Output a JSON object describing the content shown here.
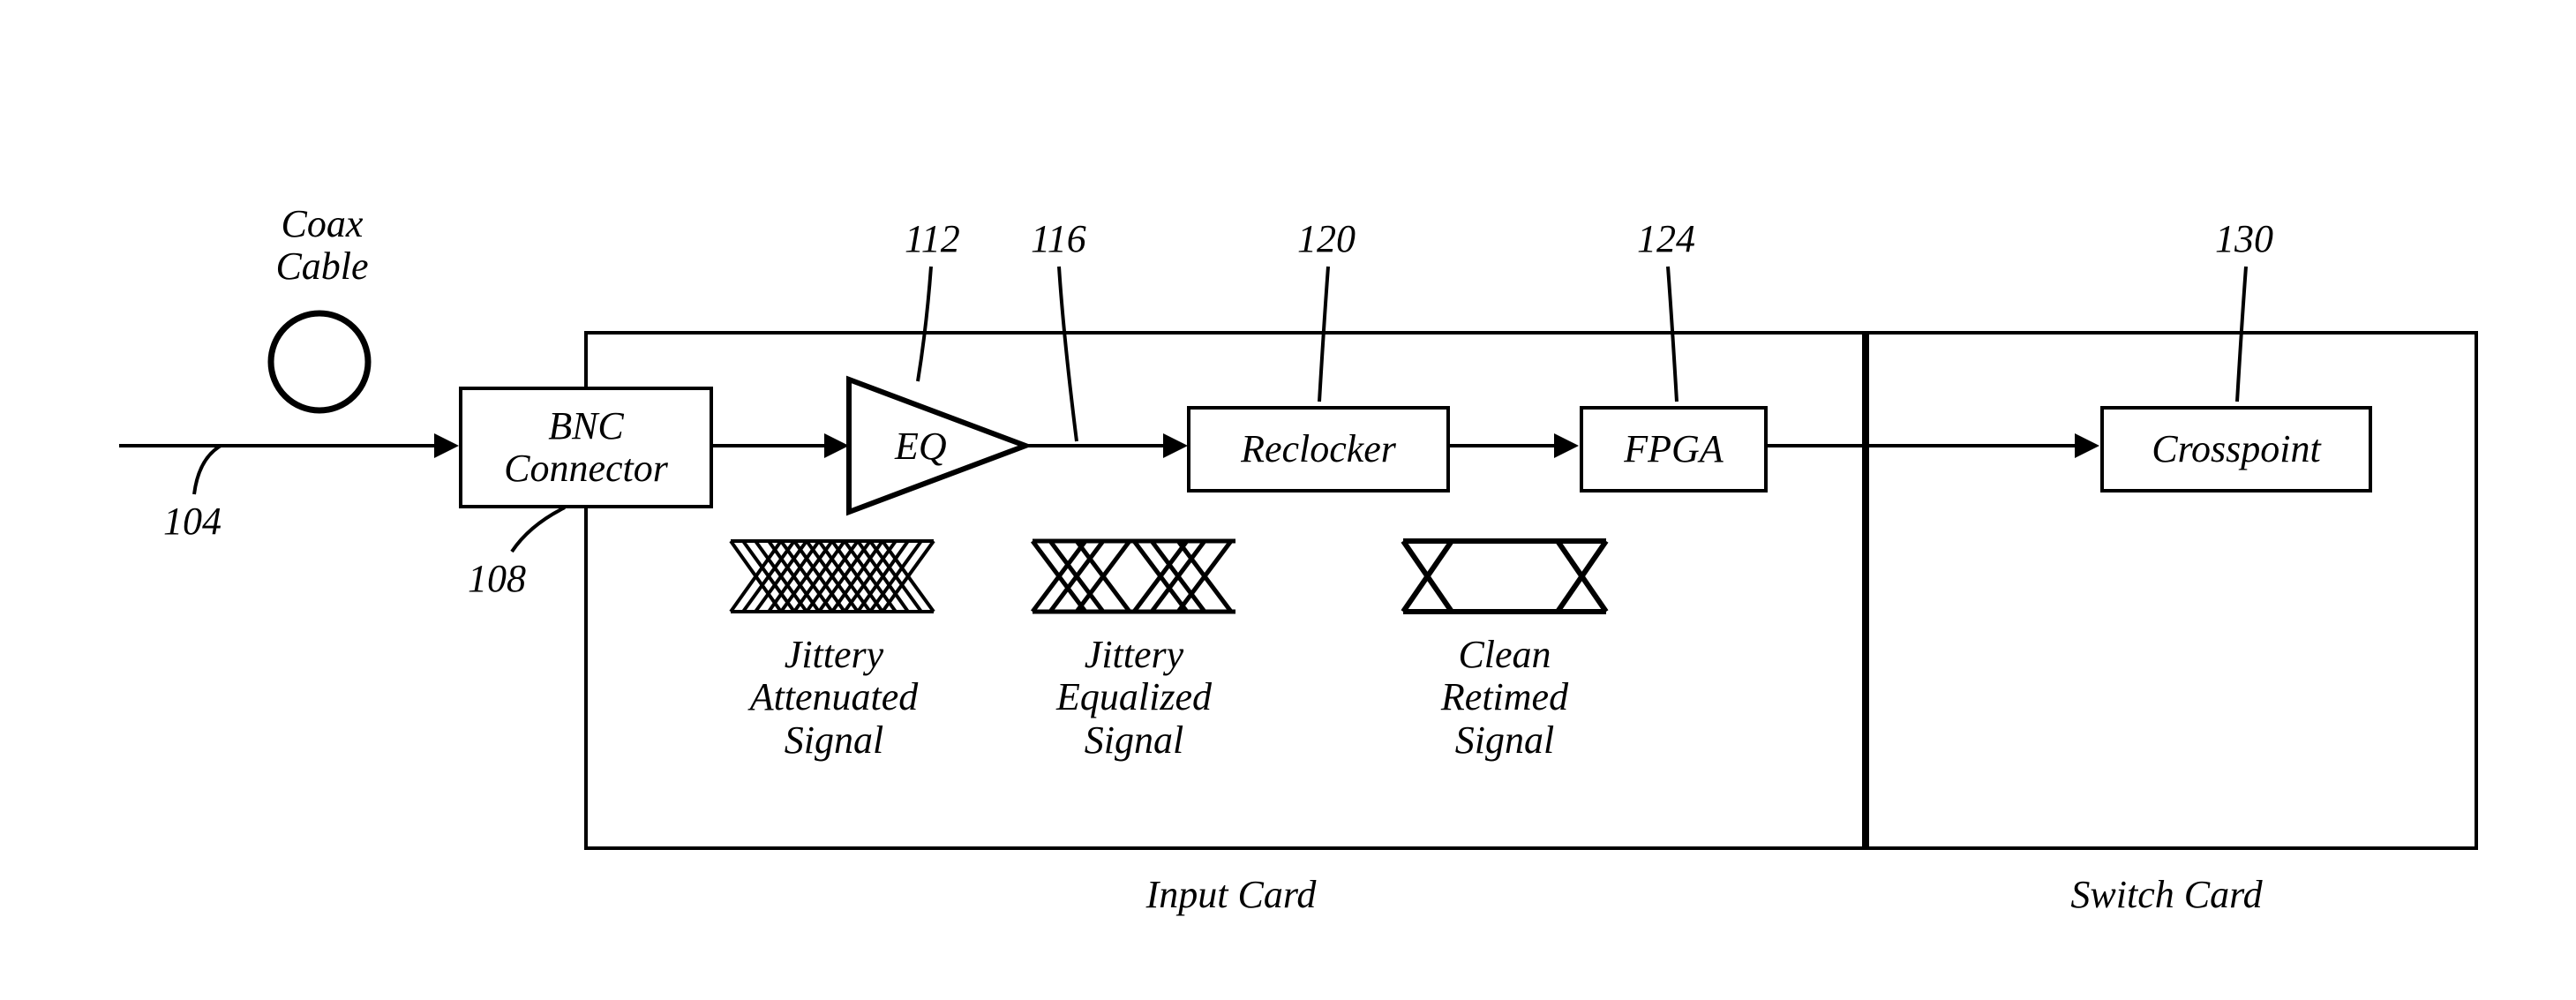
{
  "coax": {
    "label": "Coax\nCable"
  },
  "refs": {
    "r104": "104",
    "r108": "108",
    "r112": "112",
    "r116": "116",
    "r120": "120",
    "r124": "124",
    "r130": "130"
  },
  "blocks": {
    "bnc": "BNC\nConnector",
    "eq": "EQ",
    "reclocker": "Reclocker",
    "fpga": "FPGA",
    "crosspoint": "Crosspoint"
  },
  "signals": {
    "jittery_att": "Jittery\nAttenuated\nSignal",
    "jittery_eq": "Jittery\nEqualized\nSignal",
    "clean": "Clean\nRetimed\nSignal"
  },
  "cards": {
    "input": "Input Card",
    "switch": "Switch Card"
  }
}
